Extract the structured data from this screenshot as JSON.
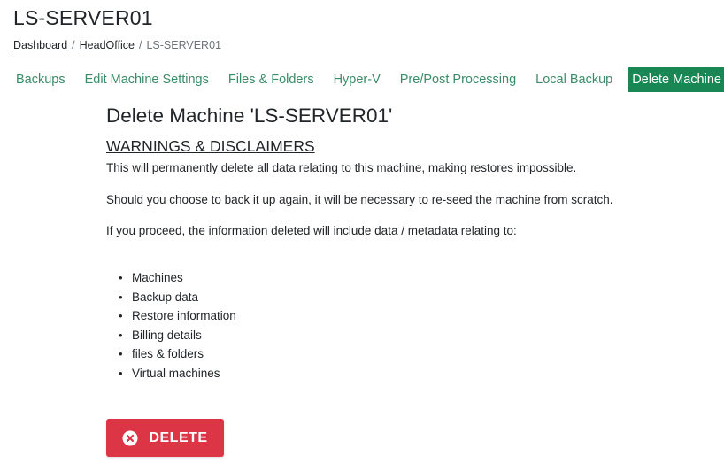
{
  "page": {
    "title": "LS-SERVER01"
  },
  "breadcrumb": {
    "items": [
      {
        "label": "Dashboard",
        "link": true
      },
      {
        "label": "HeadOffice",
        "link": true
      },
      {
        "label": "LS-SERVER01",
        "link": false
      }
    ],
    "separator": "/"
  },
  "tabs": [
    {
      "label": "Backups",
      "active": false
    },
    {
      "label": "Edit Machine Settings",
      "active": false
    },
    {
      "label": "Files & Folders",
      "active": false
    },
    {
      "label": "Hyper-V",
      "active": false
    },
    {
      "label": "Pre/Post Processing",
      "active": false
    },
    {
      "label": "Local Backup",
      "active": false
    },
    {
      "label": "Delete Machine",
      "active": true
    }
  ],
  "main": {
    "heading": "Delete Machine 'LS-SERVER01'",
    "warnings_heading": "WARNINGS & DISCLAIMERS",
    "paragraphs": [
      "This will permanently delete all data relating to this machine, making restores impossible.",
      "Should you choose to back it up again, it will be necessary to re-seed the machine from scratch.",
      "If you proceed, the information deleted will include data / metadata relating to:"
    ],
    "bullet": "•",
    "items": [
      "Machines",
      "Backup data",
      "Restore information",
      "Billing details",
      "files & folders",
      "Virtual machines"
    ],
    "delete_button": {
      "label": "DELETE",
      "icon": "x-circle-icon"
    }
  },
  "colors": {
    "tab_text": "#3a8c68",
    "tab_active_bg": "#198754",
    "delete_bg": "#dc3545",
    "text": "#212529",
    "muted": "#6c757d"
  }
}
